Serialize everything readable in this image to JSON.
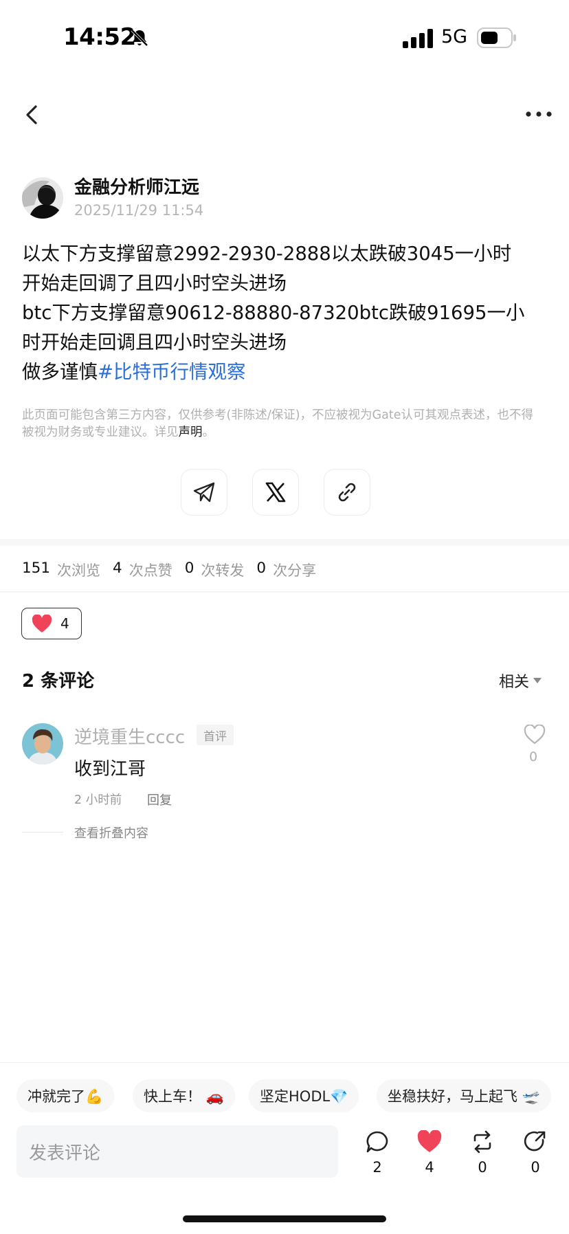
{
  "status_bar": {
    "time": "14:52",
    "network": "5G"
  },
  "post": {
    "author": "金融分析师江远",
    "time": "2025/11/29 11:54",
    "body": "以太下方支撑留意2992-2930-2888以太跌破3045一小时\n开始走回调了且四小时空头进场\nbtc下方支撑留意90612-88880-87320btc跌破91695一小\n时开始走回调且四小时空头进场\n做多谨慎",
    "hashtag": "#比特币行情观察",
    "disclaimer": "此页面可能包含第三方内容，仅供参考(非陈述/保证)，不应被视为Gate认可其观点表述，也不得被视为财务或专业建议。详见",
    "disclaimer_link": "声明",
    "disclaimer_end": "。"
  },
  "stats": {
    "views": "151",
    "views_label": "次浏览",
    "likes": "4",
    "likes_label": "次点赞",
    "reposts": "0",
    "reposts_label": "次转发",
    "shares": "0",
    "shares_label": "次分享"
  },
  "like_chip": {
    "count": "4"
  },
  "comments": {
    "title": "2 条评论",
    "sort_label": "相关",
    "items": [
      {
        "user": "逆境重生cccc",
        "badge": "首评",
        "text": "收到江哥",
        "time": "2 小时前",
        "reply": "回复",
        "likes": "0"
      }
    ],
    "fold_label": "查看折叠内容"
  },
  "quick_replies": [
    "冲就完了💪",
    "快上车！ 🚗",
    "坚定HODL💎",
    "坐稳扶好，马上起飞 🛫"
  ],
  "input": {
    "placeholder": "发表评论"
  },
  "actions": {
    "comments": "2",
    "likes": "4",
    "reposts": "0",
    "shares": "0"
  },
  "colors": {
    "hashtag": "#2b6fd6",
    "like_red": "#f0435a"
  }
}
